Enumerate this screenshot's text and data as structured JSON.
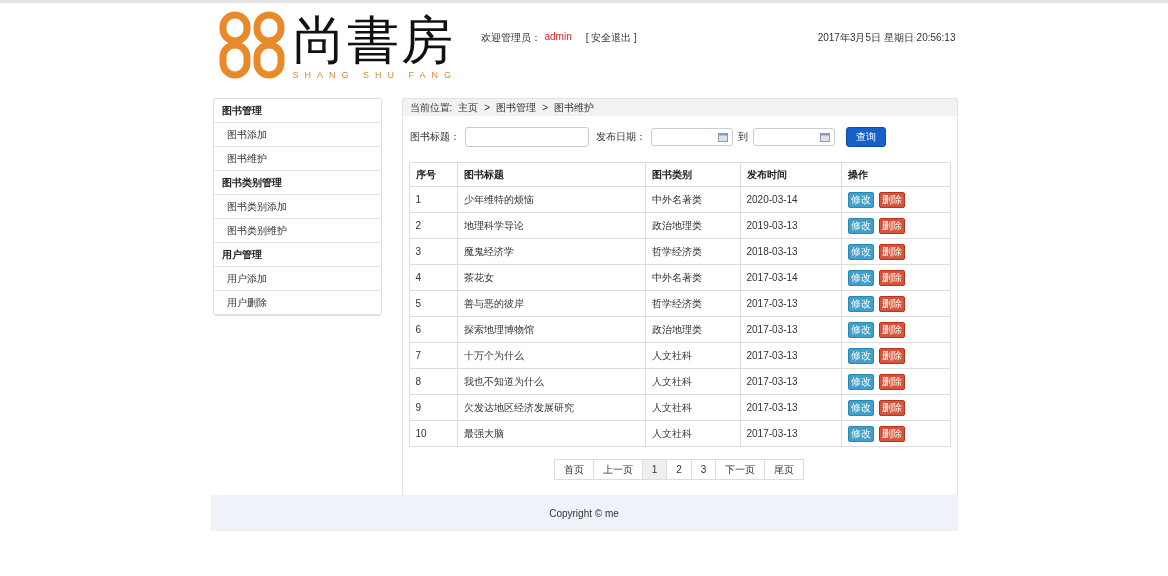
{
  "logo": {
    "title": "尚書房",
    "subtitle": "SHANG SHU FANG"
  },
  "user": {
    "greeting": "欢迎管理员：",
    "name": "admin",
    "logout": "[ 安全退出 ]"
  },
  "datetime": "2017年3月5日 星期日 20:56:13",
  "sidebar": [
    {
      "title": "图书管理",
      "items": [
        {
          "label": "图书添加",
          "selected": false
        },
        {
          "label": "图书维护",
          "selected": false
        }
      ]
    },
    {
      "title": "图书类别管理",
      "items": [
        {
          "label": "图书类别添加",
          "selected": false
        },
        {
          "label": "图书类别维护",
          "selected": false
        }
      ]
    },
    {
      "title": "用户管理",
      "items": [
        {
          "label": "用户添加",
          "selected": false
        },
        {
          "label": "用户删除",
          "selected": false
        }
      ]
    }
  ],
  "breadcrumb": {
    "label": "当前位置:",
    "path": [
      "主页",
      "图书管理",
      "图书维护"
    ],
    "separator": ">"
  },
  "search": {
    "title_label": "图书标题：",
    "date_label": "发布日期：",
    "to_label": "到",
    "button": "查询"
  },
  "table": {
    "columns": [
      "序号",
      "图书标题",
      "图书类别",
      "发布时间",
      "操作"
    ],
    "rows": [
      {
        "cells": [
          "1",
          "少年维特的烦恼",
          "中外名著类",
          "2020-03-14"
        ],
        "edit": "修改",
        "delete": "删除"
      },
      {
        "cells": [
          "2",
          "地理科学导论",
          "政治地理类",
          "2019-03-13"
        ],
        "edit": "修改",
        "delete": "删除"
      },
      {
        "cells": [
          "3",
          "魔鬼经济学",
          "哲学经济类",
          "2018-03-13"
        ],
        "edit": "修改",
        "delete": "删除"
      },
      {
        "cells": [
          "4",
          "茶花女",
          "中外名著类",
          "2017-03-14"
        ],
        "edit": "修改",
        "delete": "删除"
      },
      {
        "cells": [
          "5",
          "善与恶的彼岸",
          "哲学经济类",
          "2017-03-13"
        ],
        "edit": "修改",
        "delete": "删除"
      },
      {
        "cells": [
          "6",
          "探索地理博物馆",
          "政治地理类",
          "2017-03-13"
        ],
        "edit": "修改",
        "delete": "删除"
      },
      {
        "cells": [
          "7",
          "十万个为什么",
          "人文社科",
          "2017-03-13"
        ],
        "edit": "修改",
        "delete": "删除"
      },
      {
        "cells": [
          "8",
          "我也不知道为什么",
          "人文社科",
          "2017-03-13"
        ],
        "edit": "修改",
        "delete": "删除"
      },
      {
        "cells": [
          "9",
          "欠发达地区经济发展研究",
          "人文社科",
          "2017-03-13"
        ],
        "edit": "修改",
        "delete": "删除"
      },
      {
        "cells": [
          "10",
          "最强大脑",
          "人文社科",
          "2017-03-13"
        ],
        "edit": "修改",
        "delete": "删除"
      }
    ]
  },
  "pagination": [
    {
      "label": "首页",
      "selected": false
    },
    {
      "label": "上一页",
      "selected": false
    },
    {
      "label": "1",
      "selected": true
    },
    {
      "label": "2",
      "selected": false
    },
    {
      "label": "3",
      "selected": false
    },
    {
      "label": "下一页",
      "selected": false
    },
    {
      "label": "尾页",
      "selected": false
    }
  ],
  "footer": "Copyright © me"
}
